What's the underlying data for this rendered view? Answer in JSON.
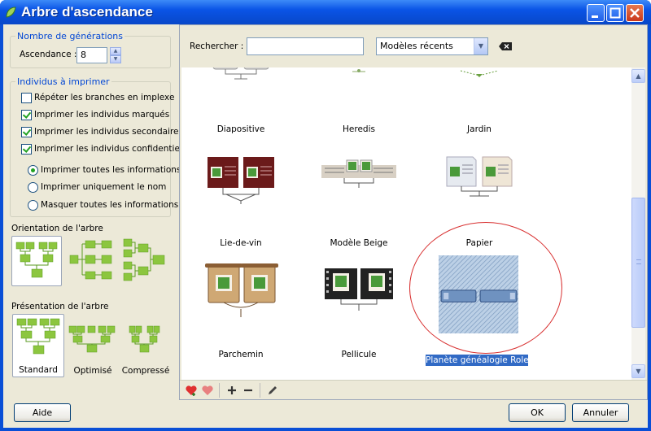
{
  "window": {
    "title": "Arbre d'ascendance"
  },
  "generations": {
    "group_title": "Nombre de générations",
    "ascendance_label": "Ascendance :",
    "ascendance_value": "8"
  },
  "individuals": {
    "group_title": "Individus à imprimer",
    "checkboxes": [
      {
        "label": "Répéter les branches en implexe",
        "checked": false
      },
      {
        "label": "Imprimer les individus marqués",
        "checked": true
      },
      {
        "label": "Imprimer les individus secondaires",
        "checked": true
      },
      {
        "label": "Imprimer les individus confidentiels",
        "checked": true
      }
    ],
    "radios": [
      {
        "label": "Imprimer toutes les informations",
        "checked": true
      },
      {
        "label": "Imprimer uniquement le nom",
        "checked": false
      },
      {
        "label": "Masquer toutes les informations",
        "checked": false
      }
    ]
  },
  "orientation": {
    "label": "Orientation de l'arbre",
    "selected_index": 0
  },
  "presentation": {
    "label": "Présentation de l'arbre",
    "options": [
      "Standard",
      "Optimisé",
      "Compressé"
    ],
    "selected_index": 0
  },
  "search": {
    "label": "Rechercher :",
    "value": "",
    "filter_selected": "Modèles récents"
  },
  "gallery": {
    "items": [
      {
        "name": "Diapositive",
        "icon": "diapositive-thumbnail"
      },
      {
        "name": "Heredis",
        "icon": "heredis-thumbnail"
      },
      {
        "name": "Jardin",
        "icon": "jardin-thumbnail"
      },
      {
        "name": "Lie-de-vin",
        "icon": "lie-de-vin-thumbnail"
      },
      {
        "name": "Modèle Beige",
        "icon": "modele-beige-thumbnail"
      },
      {
        "name": "Papier",
        "icon": "papier-thumbnail"
      },
      {
        "name": "Parchemin",
        "icon": "parchemin-thumbnail"
      },
      {
        "name": "Pellicule",
        "icon": "pellicule-thumbnail"
      },
      {
        "name": "Planète généalogie Rolem",
        "icon": "planete-genealogie-thumbnail",
        "selected": true
      }
    ]
  },
  "toolbar": {
    "tools": [
      "heart-add-icon",
      "heart-remove-icon",
      "plus-icon",
      "minus-icon",
      "pencil-icon"
    ]
  },
  "buttons": {
    "help": "Aide",
    "ok": "OK",
    "cancel": "Annuler"
  },
  "colors": {
    "accent": "#316ac5",
    "title_bar": "#0a54e6",
    "tree_green": "#8cc63f",
    "highlight_ring": "#d83030"
  }
}
